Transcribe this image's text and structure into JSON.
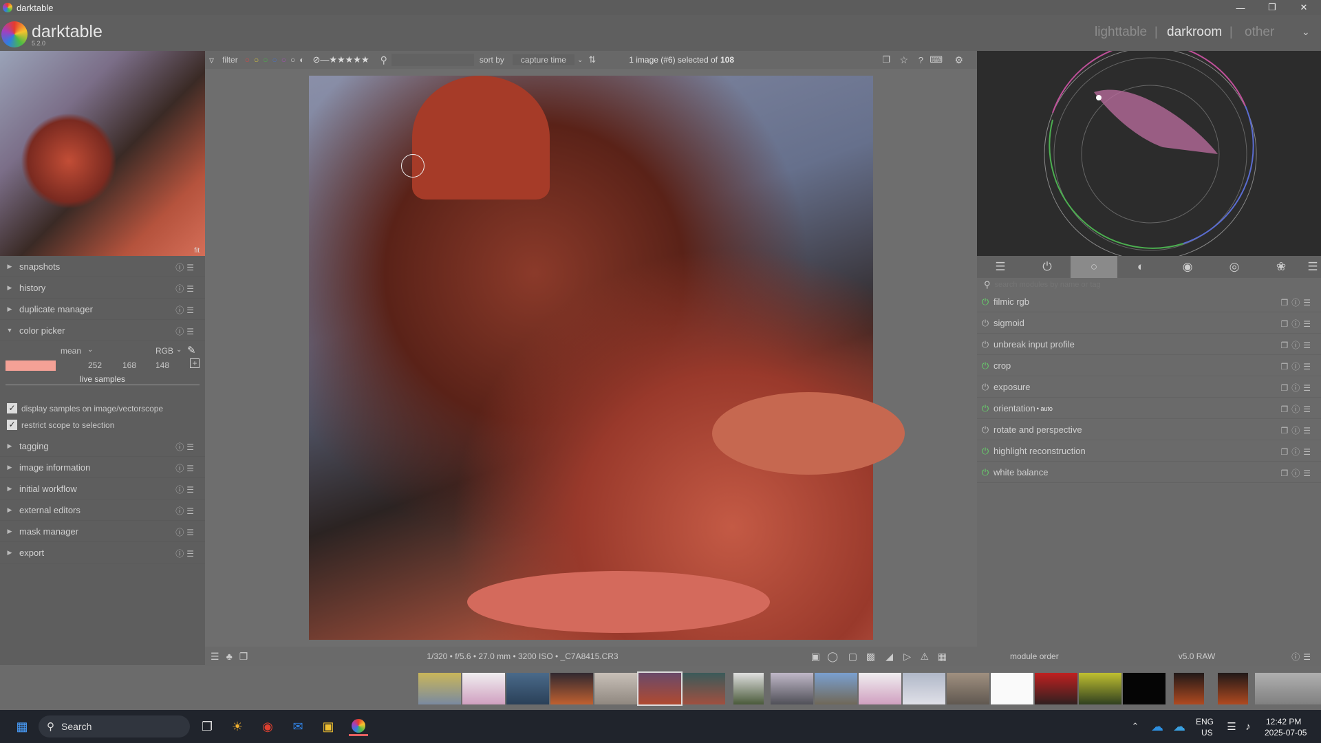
{
  "window": {
    "title": "darktable"
  },
  "app": {
    "name": "darktable",
    "version": "5.2.0",
    "views": [
      "lighttable",
      "darkroom",
      "other"
    ],
    "active_view": "darkroom"
  },
  "top_toolbar": {
    "filter_label": "filter",
    "sort_label": "sort by",
    "sort_value": "capture time",
    "selection_prefix": "1 image (#6) selected of",
    "selection_count": "108"
  },
  "preview": {
    "zoom": "fit"
  },
  "left_modules": {
    "snapshots": "snapshots",
    "history": "history",
    "duplicate_manager": "duplicate manager",
    "color_picker": "color picker",
    "tagging": "tagging",
    "image_information": "image information",
    "initial_workflow": "initial workflow",
    "external_editors": "external editors",
    "mask_manager": "mask manager",
    "export": "export"
  },
  "color_picker": {
    "mode": "mean",
    "space": "RGB",
    "r": "252",
    "g": "168",
    "b": "148",
    "swatch": "#f4a196",
    "live_samples": "live samples",
    "display_samples": "display samples on image/vectorscope",
    "restrict_scope": "restrict scope to selection"
  },
  "image_info": {
    "exif": "1/320 • f/5.6 • 27.0 mm • 3200 ISO • _C7A8415.CR3"
  },
  "right_panel": {
    "search_placeholder": "search modules by name or tag",
    "module_order_label": "module order",
    "module_order_value": "v5.0 RAW"
  },
  "right_modules": [
    {
      "name": "filmic rgb",
      "on": true,
      "badge": ""
    },
    {
      "name": "sigmoid",
      "on": false,
      "badge": ""
    },
    {
      "name": "unbreak input profile",
      "on": false,
      "badge": ""
    },
    {
      "name": "crop",
      "on": true,
      "badge": ""
    },
    {
      "name": "exposure",
      "on": false,
      "badge": ""
    },
    {
      "name": "orientation",
      "on": true,
      "badge": "• auto"
    },
    {
      "name": "rotate and perspective",
      "on": false,
      "badge": ""
    },
    {
      "name": "highlight reconstruction",
      "on": true,
      "badge": ""
    },
    {
      "name": "white balance",
      "on": true,
      "badge": ""
    }
  ],
  "taskbar": {
    "search": "Search",
    "lang1": "ENG",
    "lang2": "US",
    "time": "12:42 PM",
    "date": "2025-07-05"
  },
  "colors": {
    "accent_on": "#66d86a",
    "bg": "#6e6e6e"
  }
}
